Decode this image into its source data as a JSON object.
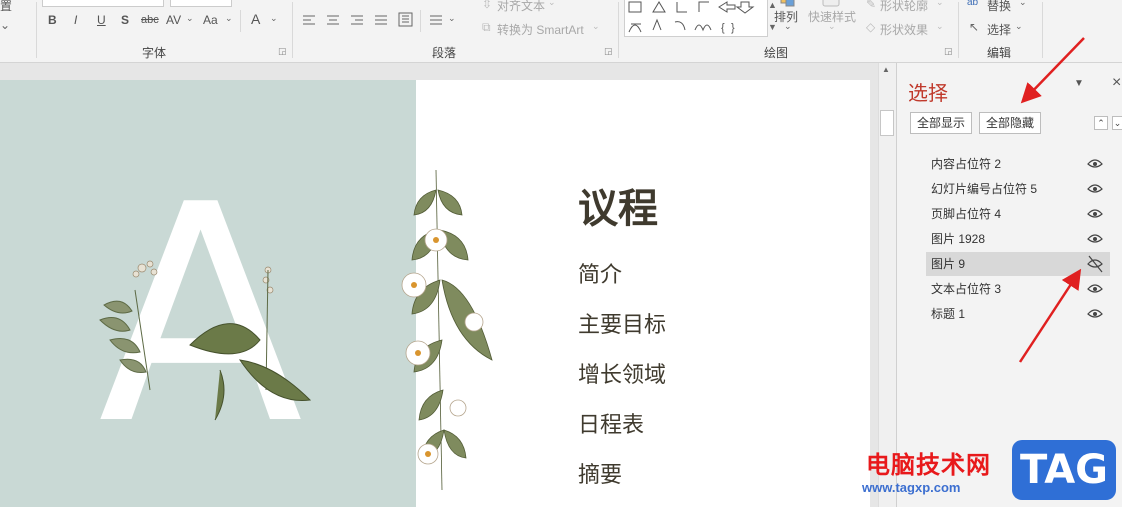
{
  "ribbon": {
    "font_group": {
      "label": "字体",
      "buttons": [
        "B",
        "I",
        "U",
        "S",
        "abc",
        "AV",
        "Aa",
        "A"
      ]
    },
    "paragraph_group": {
      "label": "段落",
      "align_text": "对齐文本",
      "convert_smartart": "转换为 SmartArt"
    },
    "drawing_group": {
      "label": "绘图",
      "arrange": "排列",
      "quick_styles": "快速样式",
      "shape_outline": "形状轮廓",
      "shape_effects": "形状效果"
    },
    "editing_group": {
      "label": "编辑",
      "replace": "替换",
      "select": "选择"
    },
    "cutoff_left": "置"
  },
  "slide": {
    "big_letter": "A",
    "title": "议程",
    "items": [
      "简介",
      "主要目标",
      "增长领域",
      "日程表",
      "摘要"
    ]
  },
  "selection_pane": {
    "title": "选择",
    "show_all": "全部显示",
    "hide_all": "全部隐藏",
    "layers": [
      {
        "name": "内容占位符 2",
        "visible": true,
        "selected": false
      },
      {
        "name": "幻灯片编号占位符 5",
        "visible": true,
        "selected": false
      },
      {
        "name": "页脚占位符 4",
        "visible": true,
        "selected": false
      },
      {
        "name": "图片 1928",
        "visible": true,
        "selected": false
      },
      {
        "name": "图片 9",
        "visible": false,
        "selected": true
      },
      {
        "name": "文本占位符 3",
        "visible": true,
        "selected": false
      },
      {
        "name": "标题 1",
        "visible": true,
        "selected": false
      }
    ]
  },
  "watermark": {
    "site_name": "电脑技术网",
    "url": "www.tagxp.com",
    "tag": "TAG"
  },
  "colors": {
    "pane_title": "#c0392b",
    "annotation_arrow": "#e02020",
    "slide_left_bg": "#c9d9d5",
    "title_text": "#3f3a2e"
  }
}
